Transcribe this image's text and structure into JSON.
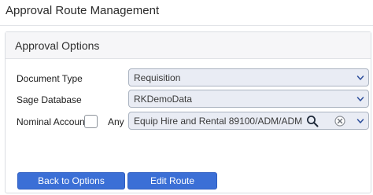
{
  "header": {
    "title": "Approval Route Management"
  },
  "panel": {
    "title": "Approval Options"
  },
  "fields": {
    "document_type": {
      "label": "Document Type",
      "value": "Requisition"
    },
    "sage_database": {
      "label": "Sage Database",
      "value": "RKDemoData"
    },
    "nominal_account": {
      "label": "Nominal Account",
      "checked": false,
      "any_label": "Any",
      "value": "Equip Hire and Rental  89100/ADM/ADM"
    }
  },
  "buttons": {
    "back_label": "Back to Options",
    "edit_label": "Edit Route"
  },
  "colors": {
    "button": "#3b6fd6",
    "select_background": "#e9ecf4",
    "chevron": "#2e4f9c"
  },
  "icons": {
    "dropdown": "chevron-down-icon",
    "search": "search-icon",
    "clear": "clear-icon"
  }
}
